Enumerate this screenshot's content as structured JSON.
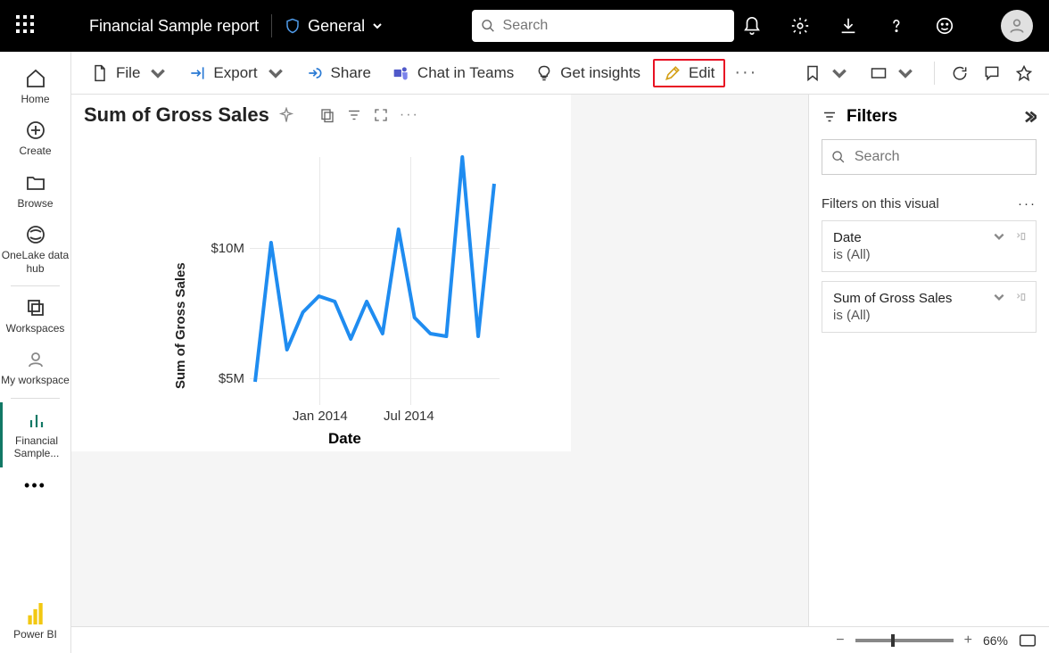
{
  "header": {
    "report_title": "Financial Sample report",
    "sensitivity_label": "General",
    "search_placeholder": "Search"
  },
  "left_nav": {
    "home": "Home",
    "create": "Create",
    "browse": "Browse",
    "onelake": "OneLake data hub",
    "workspaces": "Workspaces",
    "my_workspace": "My workspace",
    "active_report": "Financial Sample...",
    "powerbi": "Power BI"
  },
  "toolbar": {
    "file": "File",
    "export": "Export",
    "share": "Share",
    "chat_teams": "Chat in Teams",
    "get_insights": "Get insights",
    "edit": "Edit"
  },
  "visual": {
    "title": "Sum of Gross Sales",
    "y_label": "Sum of Gross Sales",
    "x_label": "Date",
    "y_tick_10m": "$10M",
    "y_tick_5m": "$5M",
    "x_tick_jan": "Jan 2014",
    "x_tick_jul": "Jul 2014"
  },
  "filters": {
    "title": "Filters",
    "search_placeholder": "Search",
    "section_title": "Filters on this visual",
    "card1_name": "Date",
    "card1_value": "is (All)",
    "card2_name": "Sum of Gross Sales",
    "card2_value": "is (All)"
  },
  "status": {
    "zoom": "66%"
  },
  "chart_data": {
    "type": "line",
    "title": "Sum of Gross Sales",
    "xlabel": "Date",
    "ylabel": "Sum of Gross Sales",
    "ylim": [
      4000000,
      13000000
    ],
    "x": [
      "Sep 2013",
      "Oct 2013",
      "Nov 2013",
      "Dec 2013",
      "Jan 2014",
      "Feb 2014",
      "Mar 2014",
      "Apr 2014",
      "May 2014",
      "Jun 2014",
      "Jul 2014",
      "Aug 2014",
      "Sep 2014",
      "Oct 2014",
      "Nov 2014",
      "Dec 2014"
    ],
    "values": [
      4600000,
      9800000,
      5800000,
      7200000,
      7800000,
      7600000,
      6200000,
      7600000,
      6400000,
      10300000,
      7000000,
      6400000,
      6300000,
      13000000,
      6300000,
      12000000
    ],
    "x_ticks": [
      "Jan 2014",
      "Jul 2014"
    ],
    "y_ticks": [
      "$5M",
      "$10M"
    ]
  }
}
